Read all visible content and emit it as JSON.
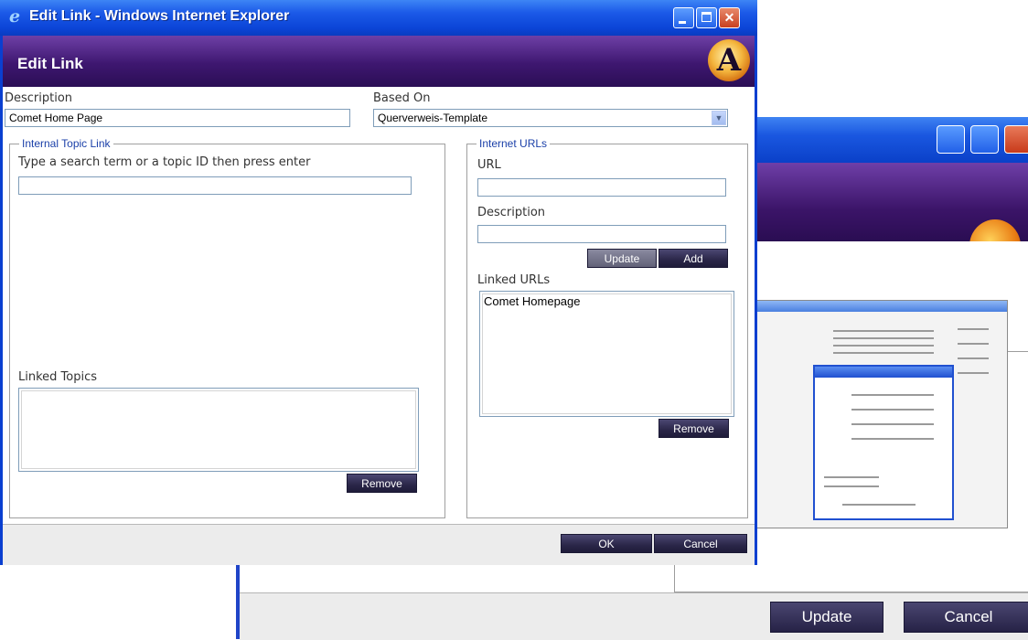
{
  "background_window": {
    "update_label": "Update",
    "cancel_label": "Cancel"
  },
  "window": {
    "title": "Edit Link - Windows Internet Explorer"
  },
  "dialog": {
    "title": "Edit Link",
    "logo_letter": "A",
    "description_label": "Description",
    "description_value": "Comet Home Page",
    "based_on_label": "Based On",
    "based_on_value": "Querverweis-Template",
    "internal": {
      "legend": "Internal Topic Link",
      "search_label": "Type a search term or a topic ID then press enter",
      "search_value": "",
      "linked_topics_label": "Linked Topics",
      "linked_topics": [],
      "remove_label": "Remove"
    },
    "internet": {
      "legend": "Internet URLs",
      "url_label": "URL",
      "url_value": "",
      "description_label": "Description",
      "description_value": "",
      "update_label": "Update",
      "add_label": "Add",
      "linked_urls_label": "Linked URLs",
      "linked_urls": [
        "Comet Homepage"
      ],
      "remove_label": "Remove"
    },
    "ok_label": "OK",
    "cancel_label": "Cancel"
  }
}
